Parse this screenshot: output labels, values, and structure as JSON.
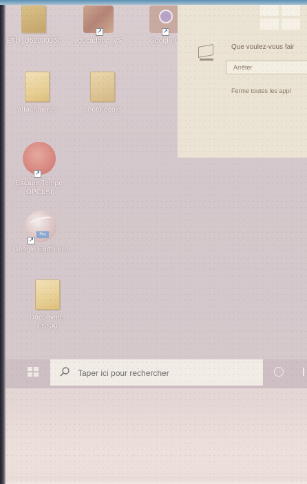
{
  "desktop": {
    "icons": [
      {
        "label": "ETU_U52000350",
        "icon": "folder-icon"
      },
      {
        "label": "educadhoc_VS",
        "icon": "app-shortcut-icon"
      },
      {
        "label": "Google C",
        "icon": "chrome-shortcut-icon"
      },
      {
        "label": "attachments",
        "icon": "folder-icon"
      },
      {
        "label": "photo ecole",
        "icon": "folder-icon"
      },
      {
        "label": "Escape Tempo",
        "label2": "OPCLSI",
        "icon": "game-shortcut-icon"
      },
      {
        "label": "Google Earth Pro",
        "icon": "google-earth-icon"
      },
      {
        "label": "Documents",
        "label2": "ESSAI",
        "icon": "folder-icon"
      }
    ]
  },
  "start_panel": {
    "question": "Que voulez-vous fair",
    "select_value": "Arrêter",
    "hint": "Ferme toutes les appl"
  },
  "taskbar": {
    "search_placeholder": "Taper ici pour rechercher"
  },
  "colors": {
    "taskbar": "#cdbfc3",
    "search_box": "#f2ece7",
    "panel": "#ebe4d4"
  }
}
